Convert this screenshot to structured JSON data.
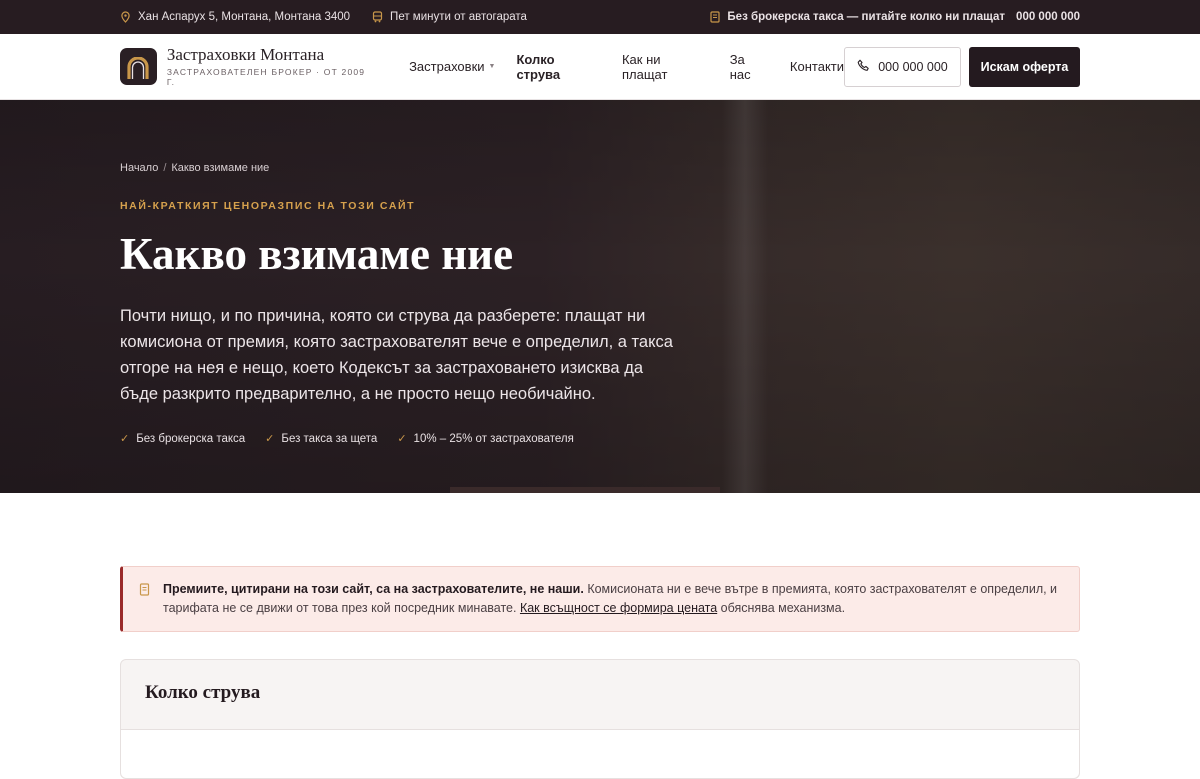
{
  "topbar": {
    "address": "Хан Аспарух 5, Монтана, Монтана 3400",
    "transit": "Пет минути от автогарата",
    "fee_note": "Без брокерска такса — питайте колко ни плащат",
    "phone": "000 000 000"
  },
  "header": {
    "brand_name": "Застраховки Монтана",
    "brand_sub": "Застрахователен брокер · от 2009 г.",
    "nav": {
      "insurance": "Застраховки",
      "pricing": "Колко струва",
      "how_paid": "Как ни плащат",
      "about": "За нас",
      "contacts": "Контакти"
    },
    "phone_button": "000 000 000",
    "cta_button": "Искам оферта"
  },
  "hero": {
    "breadcrumb_home": "Начало",
    "breadcrumb_sep": "/",
    "breadcrumb_current": "Какво взимаме ние",
    "eyebrow": "Най-краткият ценоразпис на този сайт",
    "title": "Какво взимаме ние",
    "lead": "Почти нищо, и по причина, която си струва да разберете: плащат ни комисиона от премия, която застрахователят вече е определил, а такса отгоре на нея е нещо, което Кодексът за застраховането изисква да бъде разкрито предварително, а не просто нещо необичайно.",
    "checks": [
      "Без брокерска такса",
      "Без такса за щета",
      "10% – 25% от застрахователя"
    ]
  },
  "notice": {
    "bold": "Премиите, цитирани на този сайт, са на застрахователите, не наши.",
    "text": " Комисионата ни е вече вътре в премията, която застрахователят е определил, и тарифата не се движи от това през кой посредник минавате. ",
    "link": "Как всъщност се формира цената",
    "tail": " обяснява механизма."
  },
  "card": {
    "title": "Колко струва"
  },
  "colors": {
    "dark": "#271c21",
    "gold": "#c9974a",
    "notice_bg": "#fcebe8",
    "notice_accent": "#9a2a2a"
  }
}
